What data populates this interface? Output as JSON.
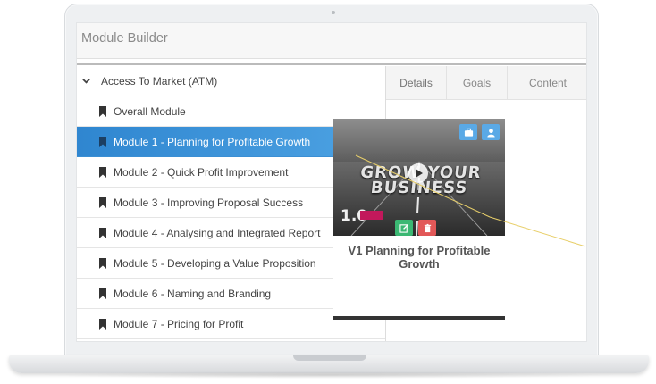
{
  "header": {
    "title": "Module Builder"
  },
  "tree": {
    "root_label": "Access To Market (ATM)",
    "items": [
      {
        "label": "Overall Module",
        "selected": false
      },
      {
        "label": "Module 1 - Planning for Profitable Growth",
        "selected": true
      },
      {
        "label": "Module 2 - Quick Profit Improvement",
        "selected": false
      },
      {
        "label": "Module 3 - Improving Proposal Success",
        "selected": false
      },
      {
        "label": "Module 4 - Analysing and Integrated Report",
        "selected": false
      },
      {
        "label": "Module 5 - Developing a Value Proposition",
        "selected": false
      },
      {
        "label": "Module 6 - Naming and Branding",
        "selected": false
      },
      {
        "label": "Module 7 - Pricing for Profit",
        "selected": false
      }
    ]
  },
  "tabs": [
    {
      "label": "Details"
    },
    {
      "label": "Goals"
    },
    {
      "label": "Content"
    }
  ],
  "content": {
    "card": {
      "thumb_text": "GROW YOUR BUSINESS",
      "thumb_number": "1.0",
      "title": "V1 Planning for Profitable Growth"
    }
  },
  "colors": {
    "accent": "#3a92d9",
    "badge_blue": "#5aa9e6",
    "badge_green": "#3bb873",
    "badge_red": "#e25858"
  },
  "icons": {
    "root": "chevron-down-icon",
    "item": "bookmark-icon",
    "badge_1": "briefcase-icon",
    "badge_2": "user-icon",
    "edit": "edit-icon",
    "delete": "trash-icon",
    "play": "play-icon"
  }
}
